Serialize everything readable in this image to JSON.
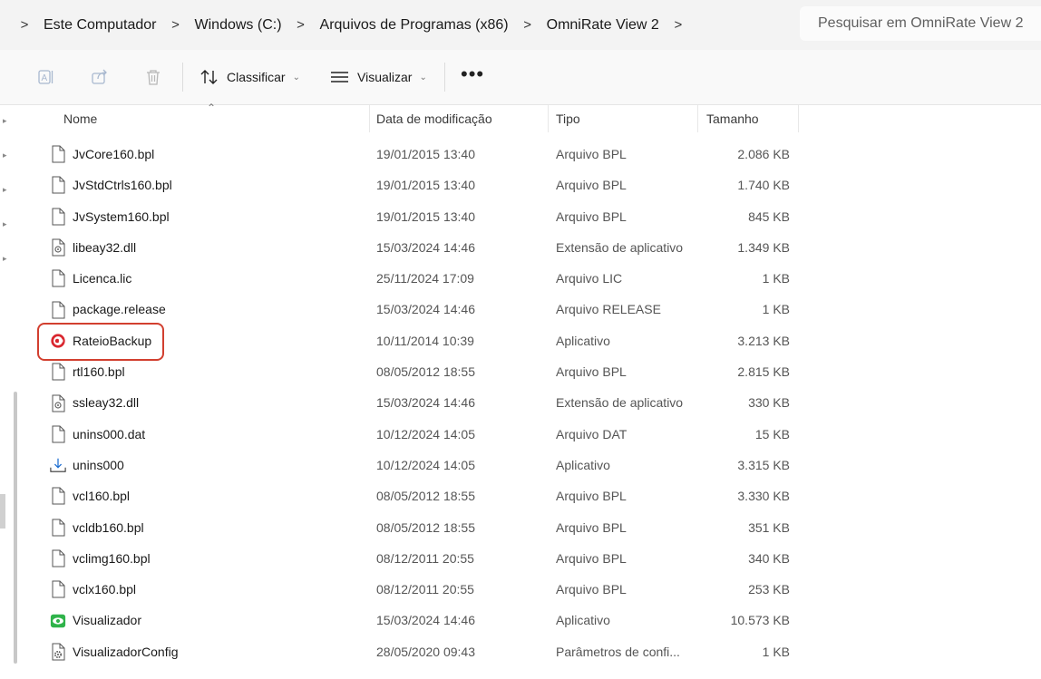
{
  "address": {
    "crumbs": [
      "Este Computador",
      "Windows (C:)",
      "Arquivos de Programas (x86)",
      "OmniRate View 2"
    ],
    "search_placeholder": "Pesquisar em OmniRate View 2"
  },
  "toolbar": {
    "sort_label": "Classificar",
    "view_label": "Visualizar",
    "more_label": "•••"
  },
  "columns": {
    "name": "Nome",
    "date": "Data de modificação",
    "type": "Tipo",
    "size": "Tamanho"
  },
  "files": [
    {
      "name": "JvCore160.bpl",
      "date": "19/01/2015 13:40",
      "type": "Arquivo BPL",
      "size": "2.086 KB",
      "icon": "file-icon"
    },
    {
      "name": "JvStdCtrls160.bpl",
      "date": "19/01/2015 13:40",
      "type": "Arquivo BPL",
      "size": "1.740 KB",
      "icon": "file-icon"
    },
    {
      "name": "JvSystem160.bpl",
      "date": "19/01/2015 13:40",
      "type": "Arquivo BPL",
      "size": "845 KB",
      "icon": "file-icon"
    },
    {
      "name": "libeay32.dll",
      "date": "15/03/2024 14:46",
      "type": "Extensão de aplicativo",
      "size": "1.349 KB",
      "icon": "dll-icon"
    },
    {
      "name": "Licenca.lic",
      "date": "25/11/2024 17:09",
      "type": "Arquivo LIC",
      "size": "1 KB",
      "icon": "file-icon"
    },
    {
      "name": "package.release",
      "date": "15/03/2024 14:46",
      "type": "Arquivo RELEASE",
      "size": "1 KB",
      "icon": "file-icon"
    },
    {
      "name": "RateioBackup",
      "date": "10/11/2014 10:39",
      "type": "Aplicativo",
      "size": "3.213 KB",
      "icon": "backup-app-icon"
    },
    {
      "name": "rtl160.bpl",
      "date": "08/05/2012 18:55",
      "type": "Arquivo BPL",
      "size": "2.815 KB",
      "icon": "file-icon"
    },
    {
      "name": "ssleay32.dll",
      "date": "15/03/2024 14:46",
      "type": "Extensão de aplicativo",
      "size": "330 KB",
      "icon": "dll-icon"
    },
    {
      "name": "unins000.dat",
      "date": "10/12/2024 14:05",
      "type": "Arquivo DAT",
      "size": "15 KB",
      "icon": "file-icon"
    },
    {
      "name": "unins000",
      "date": "10/12/2024 14:05",
      "type": "Aplicativo",
      "size": "3.315 KB",
      "icon": "uninstaller-icon"
    },
    {
      "name": "vcl160.bpl",
      "date": "08/05/2012 18:55",
      "type": "Arquivo BPL",
      "size": "3.330 KB",
      "icon": "file-icon"
    },
    {
      "name": "vcldb160.bpl",
      "date": "08/05/2012 18:55",
      "type": "Arquivo BPL",
      "size": "351 KB",
      "icon": "file-icon"
    },
    {
      "name": "vclimg160.bpl",
      "date": "08/12/2011 20:55",
      "type": "Arquivo BPL",
      "size": "340 KB",
      "icon": "file-icon"
    },
    {
      "name": "vclx160.bpl",
      "date": "08/12/2011 20:55",
      "type": "Arquivo BPL",
      "size": "253 KB",
      "icon": "file-icon"
    },
    {
      "name": "Visualizador",
      "date": "15/03/2024 14:46",
      "type": "Aplicativo",
      "size": "10.573 KB",
      "icon": "viewer-app-icon"
    },
    {
      "name": "VisualizadorConfig",
      "date": "28/05/2020 09:43",
      "type": "Parâmetros de confi...",
      "size": "1 KB",
      "icon": "config-icon"
    }
  ],
  "colors": {
    "highlight": "#d23f2f",
    "backup_icon": "#d9262e",
    "viewer_icon": "#2fb34a"
  }
}
